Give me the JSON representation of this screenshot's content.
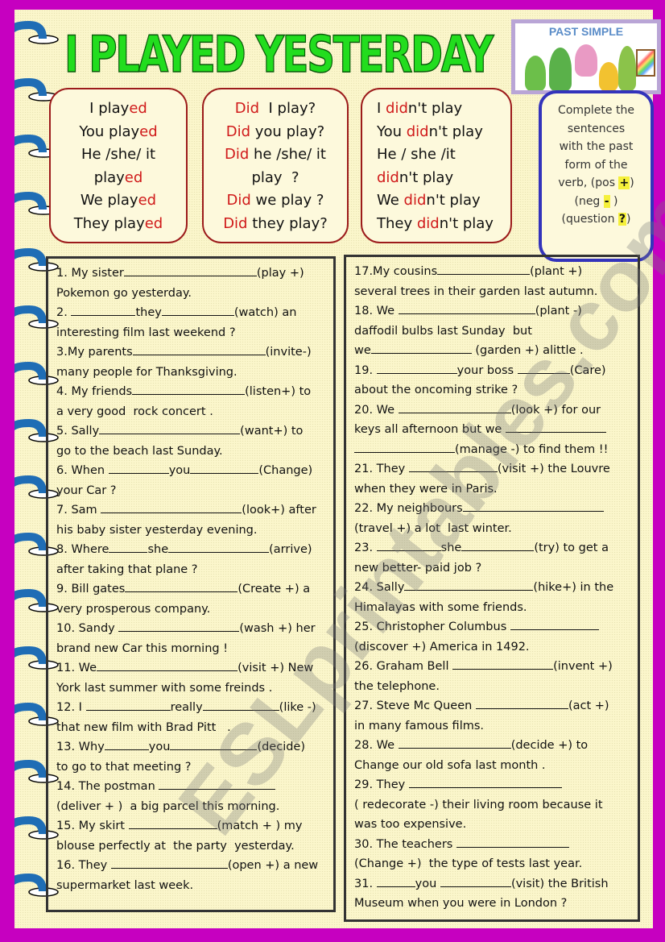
{
  "title": "I PLAYED YESTERDAY",
  "picture": {
    "label": "PAST SIMPLE"
  },
  "affirmative": [
    [
      {
        "t": "I play"
      },
      {
        "t": "ed",
        "red": true
      }
    ],
    [
      {
        "t": "You play"
      },
      {
        "t": "ed",
        "red": true
      }
    ],
    [
      {
        "t": "He /she/ it"
      }
    ],
    [
      {
        "t": "play"
      },
      {
        "t": "ed",
        "red": true
      }
    ],
    [
      {
        "t": "We play"
      },
      {
        "t": "ed",
        "red": true
      }
    ],
    [
      {
        "t": "They play"
      },
      {
        "t": "ed",
        "red": true
      }
    ]
  ],
  "questions": [
    [
      {
        "t": "Did",
        "red": true
      },
      {
        "t": "  I play?"
      }
    ],
    [
      {
        "t": "Did",
        "red": true
      },
      {
        "t": " you play?"
      }
    ],
    [
      {
        "t": "Did",
        "red": true
      },
      {
        "t": " he /she/ it"
      }
    ],
    [
      {
        "t": "play  ?"
      }
    ],
    [
      {
        "t": "Did",
        "red": true
      },
      {
        "t": " we play ?"
      }
    ],
    [
      {
        "t": "Did",
        "red": true
      },
      {
        "t": " they play?"
      }
    ]
  ],
  "negatives": [
    [
      {
        "t": "I "
      },
      {
        "t": "did",
        "red": true
      },
      {
        "t": "n't play"
      }
    ],
    [
      {
        "t": "You "
      },
      {
        "t": "did",
        "red": true
      },
      {
        "t": "n't play"
      }
    ],
    [
      {
        "t": "He / she /it"
      }
    ],
    [
      {
        "t": "did",
        "red": true
      },
      {
        "t": "n't play"
      }
    ],
    [
      {
        "t": "We "
      },
      {
        "t": "did",
        "red": true
      },
      {
        "t": "n't play"
      }
    ],
    [
      {
        "t": "They "
      },
      {
        "t": "did",
        "red": true
      },
      {
        "t": "n't play"
      }
    ]
  ],
  "instructions": {
    "lines": [
      "Complete the",
      "sentences",
      "with the past",
      "form of the"
    ],
    "pos_prefix": "verb, (pos ",
    "pos_sign": "+",
    "pos_suffix": ")",
    "neg_prefix": "(neg ",
    "neg_sign": "-",
    "neg_suffix": " )",
    "q_prefix": "(question ",
    "q_sign": "?",
    "q_suffix": ")"
  },
  "exercises_left": [
    [
      {
        "t": "1. My sister"
      },
      {
        "b": 165
      },
      {
        "t": "(play +)"
      }
    ],
    [
      {
        "t": "Pokemon go yesterday."
      }
    ],
    [
      {
        "t": "2. "
      },
      {
        "b": 80
      },
      {
        "t": "they"
      },
      {
        "b": 90
      },
      {
        "t": "(watch) an"
      }
    ],
    [
      {
        "t": "interesting film last weekend ?"
      }
    ],
    [
      {
        "t": "3.My parents"
      },
      {
        "b": 165
      },
      {
        "t": "(invite-)"
      }
    ],
    [
      {
        "t": "many people for Thanksgiving."
      }
    ],
    [
      {
        "t": "4. My friends"
      },
      {
        "b": 140
      },
      {
        "t": "(listen+) to"
      }
    ],
    [
      {
        "t": "a very good  rock concert ."
      }
    ],
    [
      {
        "t": "5. Sally"
      },
      {
        "b": 175
      },
      {
        "t": "(want+) to"
      }
    ],
    [
      {
        "t": "go to the beach last Sunday."
      }
    ],
    [
      {
        "t": "6. When "
      },
      {
        "b": 75
      },
      {
        "t": "you"
      },
      {
        "b": 85
      },
      {
        "t": "(Change)"
      }
    ],
    [
      {
        "t": "your Car ?"
      }
    ],
    [
      {
        "t": "7. Sam "
      },
      {
        "b": 175
      },
      {
        "t": "(look+) after"
      }
    ],
    [
      {
        "t": "his baby sister yesterday evening."
      }
    ],
    [
      {
        "t": "8. Where"
      },
      {
        "b": 48
      },
      {
        "t": "she"
      },
      {
        "b": 125
      },
      {
        "t": "(arrive)"
      }
    ],
    [
      {
        "t": "after taking that plane ?"
      }
    ],
    [
      {
        "t": "9. Bill gates"
      },
      {
        "b": 140
      },
      {
        "t": "(Create +) a"
      }
    ],
    [
      {
        "t": "very prosperous company."
      }
    ],
    [
      {
        "t": "10. Sandy "
      },
      {
        "b": 150
      },
      {
        "t": "(wash +) her"
      }
    ],
    [
      {
        "t": "brand new Car this morning !"
      }
    ],
    [
      {
        "t": "11. We"
      },
      {
        "b": 175
      },
      {
        "t": "(visit +) New"
      }
    ],
    [
      {
        "t": "York last summer with some freinds ."
      }
    ],
    [
      {
        "t": "12. I "
      },
      {
        "b": 105
      },
      {
        "t": "really"
      },
      {
        "b": 95
      },
      {
        "t": "(like -)"
      }
    ],
    [
      {
        "t": "that new film with Brad Pitt   ."
      }
    ],
    [
      {
        "t": "13. Why"
      },
      {
        "b": 55
      },
      {
        "t": "you"
      },
      {
        "b": 108
      },
      {
        "t": "(decide)"
      }
    ],
    [
      {
        "t": "to go to that meeting ?"
      }
    ],
    [
      {
        "t": "14. The postman "
      },
      {
        "b": 145
      }
    ],
    [
      {
        "t": "(deliver + )  a big parcel this morning."
      }
    ],
    [
      {
        "t": "15. My skirt "
      },
      {
        "b": 110
      },
      {
        "t": "(match + ) my"
      }
    ],
    [
      {
        "t": "blouse perfectly at  the party  yesterday."
      }
    ],
    [
      {
        "t": "16. They "
      },
      {
        "b": 145
      },
      {
        "t": "(open +) a new"
      }
    ],
    [
      {
        "t": "supermarket last week."
      }
    ]
  ],
  "exercises_right": [
    [
      {
        "t": "17.My cousins"
      },
      {
        "b": 115
      },
      {
        "t": "(plant +)"
      }
    ],
    [
      {
        "t": "several trees in their garden last autumn."
      }
    ],
    [
      {
        "t": "18. We "
      },
      {
        "b": 170
      },
      {
        "t": "(plant -)"
      }
    ],
    [
      {
        "t": "daffodil bulbs last Sunday  but"
      }
    ],
    [
      {
        "t": "we"
      },
      {
        "b": 125
      },
      {
        "t": " (garden +) alittle ."
      }
    ],
    [
      {
        "t": "19. "
      },
      {
        "b": 100
      },
      {
        "t": "your boss "
      },
      {
        "b": 65
      },
      {
        "t": "(Care)"
      }
    ],
    [
      {
        "t": "about the oncoming strike ?"
      }
    ],
    [
      {
        "t": "20. We "
      },
      {
        "b": 140
      },
      {
        "t": "(look +) for our"
      }
    ],
    [
      {
        "t": "keys all afternoon but we "
      },
      {
        "b": 125
      }
    ],
    [
      {
        "b": 125
      },
      {
        "t": "(manage -) to find them !!"
      }
    ],
    [
      {
        "t": "21. They "
      },
      {
        "b": 110
      },
      {
        "t": "(visit +) the Louvre"
      }
    ],
    [
      {
        "t": "when they were in Paris."
      }
    ],
    [
      {
        "t": "22. My neighbours"
      },
      {
        "b": 175
      }
    ],
    [
      {
        "t": "(travel +) a lot  last winter."
      }
    ],
    [
      {
        "t": "23. "
      },
      {
        "b": 80
      },
      {
        "t": "she"
      },
      {
        "b": 90
      },
      {
        "t": "(try) to get a"
      }
    ],
    [
      {
        "t": "new better- paid job ?"
      }
    ],
    [
      {
        "t": "24. Sally"
      },
      {
        "b": 160
      },
      {
        "t": "(hike+) in the"
      }
    ],
    [
      {
        "t": "Himalayas with some friends."
      }
    ],
    [
      {
        "t": "25. Christopher Columbus "
      },
      {
        "b": 110
      }
    ],
    [
      {
        "t": "(discover +) America in 1492."
      }
    ],
    [
      {
        "t": "26. Graham Bell "
      },
      {
        "b": 125
      },
      {
        "t": "(invent +)"
      }
    ],
    [
      {
        "t": "the telephone."
      }
    ],
    [
      {
        "t": "27. Steve Mc Queen "
      },
      {
        "b": 115
      },
      {
        "t": "(act +)"
      }
    ],
    [
      {
        "t": "in many famous films."
      }
    ],
    [
      {
        "t": "28. We "
      },
      {
        "b": 140
      },
      {
        "t": "(decide +) to"
      }
    ],
    [
      {
        "t": "Change our old sofa last month ."
      }
    ],
    [
      {
        "t": "29. They "
      },
      {
        "b": 190
      }
    ],
    [
      {
        "t": "( redecorate -) their living room because it"
      }
    ],
    [
      {
        "t": "was too expensive."
      }
    ],
    [
      {
        "t": "30. The teachers "
      },
      {
        "b": 140
      }
    ],
    [
      {
        "t": "(Change +)  the type of tests last year."
      }
    ],
    [
      {
        "t": "31. "
      },
      {
        "b": 48
      },
      {
        "t": "you "
      },
      {
        "b": 88
      },
      {
        "t": "(visit) the British"
      }
    ],
    [
      {
        "t": "Museum when you were in London ?"
      }
    ]
  ],
  "watermark": "ESLprintables.com",
  "colors": {
    "border_magenta": "#c600c0",
    "paper": "#fbf6cb",
    "title_green": "#22dd1e",
    "red_accent": "#d01a1a",
    "box_border": "#9c1b1b",
    "instr_border": "#3333bb",
    "spiral_blue": "#1f6db5",
    "highlight": "#f5f03a"
  }
}
